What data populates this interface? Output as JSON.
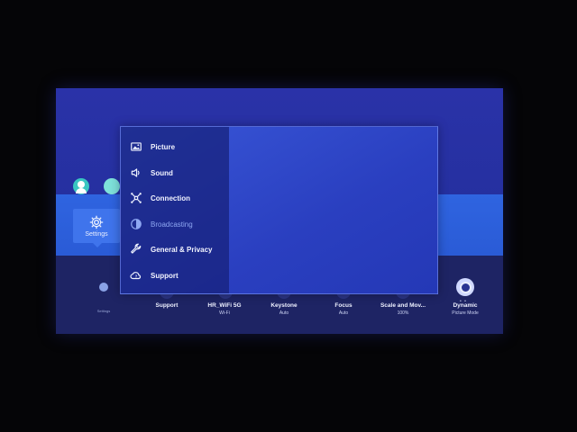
{
  "home": {
    "settings_tile": {
      "label": "Settings",
      "icon": "gear-icon"
    },
    "small_dot_label": "Settings",
    "quick_settings": [
      {
        "title": "Support",
        "subtitle": ""
      },
      {
        "title": "HR_WiFi 5G",
        "subtitle": "Wi-Fi"
      },
      {
        "title": "Keystone",
        "subtitle": "Auto"
      },
      {
        "title": "Focus",
        "subtitle": "Auto"
      },
      {
        "title": "Scale and Mov...",
        "subtitle": "100%"
      },
      {
        "title": "Dynamic",
        "subtitle": "Picture Mode"
      }
    ]
  },
  "settings_menu": {
    "items": [
      {
        "label": "Picture",
        "icon": "picture-icon",
        "enabled": true
      },
      {
        "label": "Sound",
        "icon": "speaker-icon",
        "enabled": true
      },
      {
        "label": "Connection",
        "icon": "connection-icon",
        "enabled": true
      },
      {
        "label": "Broadcasting",
        "icon": "broadcast-icon",
        "enabled": false
      },
      {
        "label": "General & Privacy",
        "icon": "wrench-icon",
        "enabled": true
      },
      {
        "label": "Support",
        "icon": "support-cloud-icon",
        "enabled": true
      }
    ]
  },
  "colors": {
    "background": "#2530a0",
    "band": "#2f64e0",
    "menu_panel": "#3957d8",
    "menu_text": "#f2f4ff",
    "disabled_text": "#8ea7f2"
  }
}
